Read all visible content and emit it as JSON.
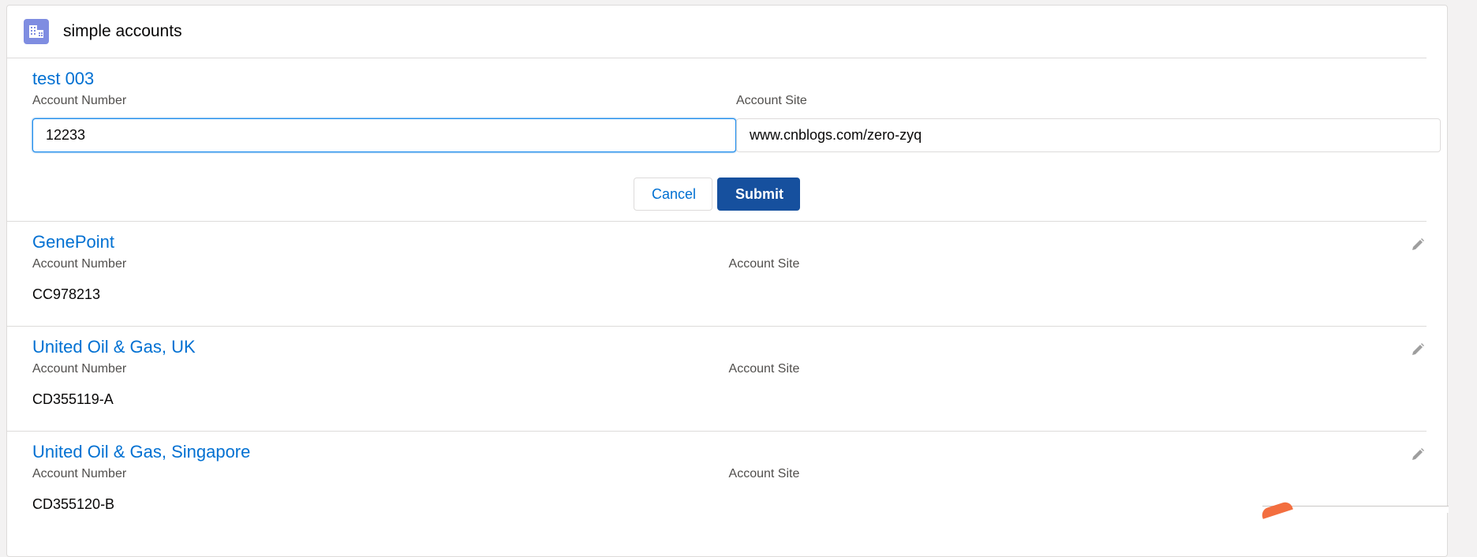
{
  "header": {
    "title": "simple accounts",
    "icon": "account-building-icon",
    "icon_color": "#7f8de1"
  },
  "form": {
    "record_name": "test 003",
    "account_number_label": "Account Number",
    "account_number_value": "12233",
    "account_site_label": "Account Site",
    "account_site_value": "www.cnblogs.com/zero-zyq",
    "cancel_label": "Cancel",
    "submit_label": "Submit"
  },
  "records": [
    {
      "name": "GenePoint",
      "account_number_label": "Account Number",
      "account_number": "CC978213",
      "account_site_label": "Account Site",
      "account_site": ""
    },
    {
      "name": "United Oil & Gas, UK",
      "account_number_label": "Account Number",
      "account_number": "CD355119-A",
      "account_site_label": "Account Site",
      "account_site": ""
    },
    {
      "name": "United Oil & Gas, Singapore",
      "account_number_label": "Account Number",
      "account_number": "CD355120-B",
      "account_site_label": "Account Site",
      "account_site": ""
    }
  ],
  "colors": {
    "link": "#0070d2",
    "brand": "#16509e",
    "border": "#dddbda"
  }
}
